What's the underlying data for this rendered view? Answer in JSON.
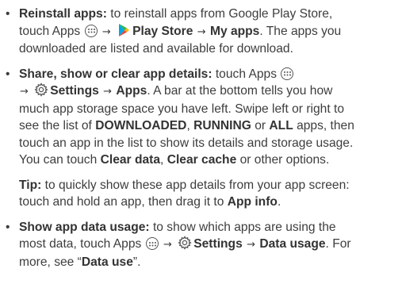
{
  "reinstall": {
    "bullet": "•",
    "head": "Reinstall apps:",
    "t1": " to reinstall apps from Google Play Store,",
    "t2": "touch Apps ",
    "arrow": "→",
    "play_store": "Play Store",
    "my_apps": "My apps",
    "t3": ". The apps you",
    "t4": "downloaded are listed and available for download."
  },
  "share": {
    "bullet": "•",
    "head": "Share, show or clear app details:",
    "t1": " touch Apps ",
    "arrow": "→",
    "settings": "Settings",
    "apps": "Apps",
    "t2": ". A bar at the bottom tells you how",
    "t3": "much app storage space you have left. Swipe left or right to",
    "t4": "see the list of ",
    "downloaded": "DOWNLOADED",
    "comma": ", ",
    "running": "RUNNING",
    "or": " or ",
    "all": "ALL",
    "t5": " apps, then",
    "t6": "touch an app in the list to show its details and storage usage.",
    "t7": "You can touch ",
    "clear_data": "Clear data",
    "comma2": ", ",
    "clear_cache": "Clear cache",
    "t8": " or other options."
  },
  "tip": {
    "head": "Tip:",
    "t1": " to quickly show these app details from your app screen:",
    "t2": "touch and hold an app, then drag it to ",
    "app_info": "App info",
    "period": "."
  },
  "usage": {
    "bullet": "•",
    "head": "Show app data usage:",
    "t1": " to show which apps are using the",
    "t2": "most data, touch Apps ",
    "arrow": "→",
    "settings": "Settings",
    "data_usage": "Data usage",
    "t3": ". For",
    "t4": "more, see “",
    "data_use": "Data use",
    "t5": "”."
  },
  "colors": {
    "text": "#3d3d3d",
    "icon": "#555555"
  },
  "icons": [
    "apps-icon",
    "play-store-icon",
    "settings-icon"
  ]
}
